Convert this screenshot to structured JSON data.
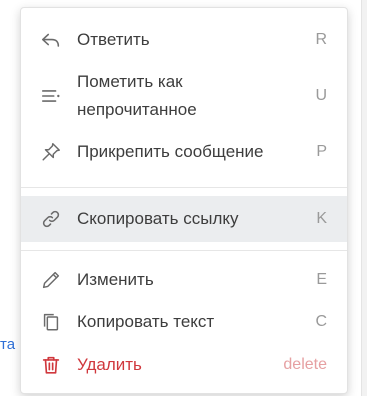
{
  "background": {
    "fragment_text": "та"
  },
  "menu": {
    "items": [
      {
        "label": "Ответить",
        "shortcut": "R",
        "icon": "reply-icon"
      },
      {
        "label": "Пометить как\nнепрочитанное",
        "shortcut": "U",
        "icon": "mark-unread-icon"
      },
      {
        "label": "Прикрепить сообщение",
        "shortcut": "P",
        "icon": "pin-icon"
      },
      {
        "label": "Скопировать ссылку",
        "shortcut": "K",
        "icon": "link-icon"
      },
      {
        "label": "Изменить",
        "shortcut": "E",
        "icon": "pencil-icon"
      },
      {
        "label": "Копировать текст",
        "shortcut": "C",
        "icon": "copy-icon"
      },
      {
        "label": "Удалить",
        "shortcut": "delete",
        "icon": "trash-icon"
      }
    ],
    "highlighted_item": "Скопировать ссылку",
    "colors": {
      "text": "#3d3d3d",
      "shortcut": "#9a9a9a",
      "danger": "#d0383d",
      "danger_shortcut": "#e6a0a2",
      "highlight": "#ebedef"
    }
  }
}
